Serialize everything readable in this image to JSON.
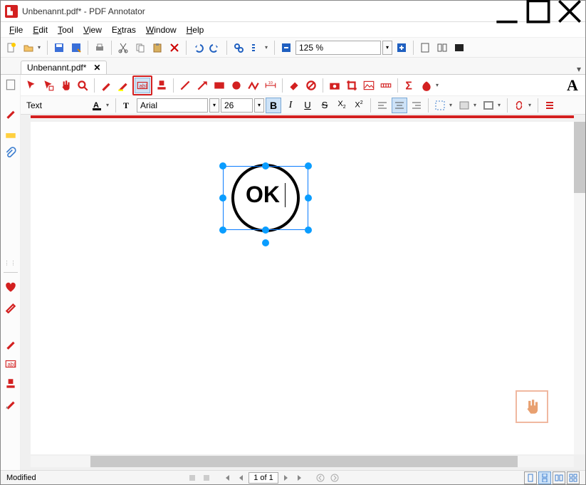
{
  "window": {
    "title": "Unbenannt.pdf* - PDF Annotator"
  },
  "menus": {
    "file": "File",
    "edit": "Edit",
    "tool": "Tool",
    "view": "View",
    "extras": "Extras",
    "window": "Window",
    "help": "Help"
  },
  "toolbar": {
    "zoom": "125 %"
  },
  "tab": {
    "name": "Unbenannt.pdf*"
  },
  "texttool": {
    "mode": "Text",
    "font": "Arial",
    "size": "26"
  },
  "shape": {
    "text": "OK"
  },
  "status": {
    "modified": "Modified",
    "page": "1 of 1"
  },
  "colors": {
    "accent": "#d32020",
    "selection": "#0a9dff"
  }
}
